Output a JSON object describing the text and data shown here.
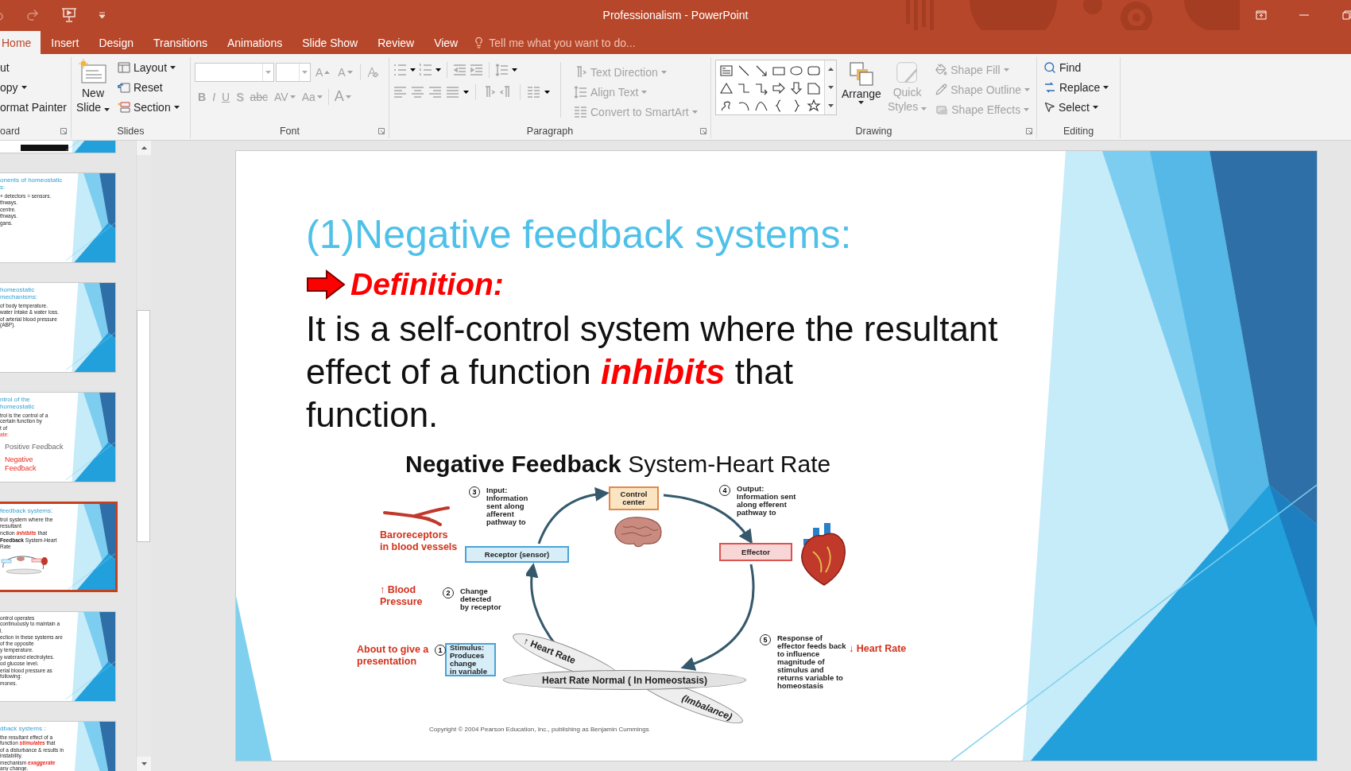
{
  "window": {
    "title": "Professionalism - PowerPoint"
  },
  "tabs": [
    {
      "label": "Home",
      "selected": true
    },
    {
      "label": "Insert",
      "selected": false
    },
    {
      "label": "Design",
      "selected": false
    },
    {
      "label": "Transitions",
      "selected": false
    },
    {
      "label": "Animations",
      "selected": false
    },
    {
      "label": "Slide Show",
      "selected": false
    },
    {
      "label": "Review",
      "selected": false
    },
    {
      "label": "View",
      "selected": false
    }
  ],
  "tell_me": {
    "placeholder": "Tell me what you want to do..."
  },
  "ribbon": {
    "clipboard": {
      "label": "oard",
      "cut": "ut",
      "copy": "opy",
      "format_painter": "ormat Painter"
    },
    "slides": {
      "label": "Slides",
      "new_slide": "New Slide",
      "layout": "Layout",
      "reset": "Reset",
      "section": "Section"
    },
    "font": {
      "label": "Font",
      "disabled": true,
      "grow": "A",
      "shrink": "A",
      "buttons": [
        {
          "text": "B",
          "kind": "bold"
        },
        {
          "text": "I",
          "kind": "italic"
        },
        {
          "text": "U",
          "kind": "underline"
        },
        {
          "text": "S",
          "kind": "shadow"
        },
        {
          "text": "abc",
          "kind": "strike"
        },
        {
          "text": "AV",
          "kind": "spacing"
        },
        {
          "text": "Aa",
          "kind": "case"
        },
        {
          "text": "A",
          "kind": "color"
        }
      ]
    },
    "paragraph": {
      "label": "Paragraph",
      "disabled": true,
      "text_direction": "Text Direction",
      "align_text": "Align Text",
      "convert": "Convert to SmartArt"
    },
    "drawing": {
      "label": "Drawing",
      "arrange": {
        "label": "Arrange",
        "disabled": false
      },
      "quick_styles": {
        "label": "Quick Styles",
        "disabled": true
      },
      "items": [
        {
          "label": "Shape Fill",
          "disabled": true
        },
        {
          "label": "Shape Outline",
          "disabled": true
        },
        {
          "label": "Shape Effects",
          "disabled": true
        }
      ]
    },
    "editing": {
      "label": "Editing",
      "items": [
        {
          "label": "Find"
        },
        {
          "label": "Replace"
        },
        {
          "label": "Select"
        }
      ]
    }
  },
  "thumbnails": [
    {
      "kind": "blank",
      "selected": false
    },
    {
      "kind": "text",
      "selected": false,
      "title": "onents of homeostatic\ns:",
      "lines": [
        {
          "text": "+ detectors = sensors.",
          "kind": "body"
        },
        {
          "text": "thways.",
          "kind": "body"
        },
        {
          "text": "centre.",
          "kind": "body"
        },
        {
          "text": "thways.",
          "kind": "body"
        },
        {
          "text": "gans.",
          "kind": "body"
        }
      ]
    },
    {
      "kind": "text",
      "selected": false,
      "title": "homeostatic mechanisms:",
      "lines": [
        {
          "text": "of body temperature.",
          "kind": "body"
        },
        {
          "text": "water intake & water loss.",
          "kind": "body"
        },
        {
          "text": "of arterial blood pressure (ABP).",
          "kind": "body"
        }
      ]
    },
    {
      "kind": "text",
      "selected": false,
      "title": "ntrol of the homeostatic",
      "lines": [
        {
          "text": "trol is the control of a certain function by",
          "kind": "body"
        },
        {
          "text": "t of",
          "kind": "body"
        },
        {
          "text": "ate:",
          "kind": "accent"
        },
        {
          "text": "Positive Feedback",
          "kind": "large"
        },
        {
          "text": "Negative Feedback",
          "kind": "large-accent"
        }
      ]
    },
    {
      "kind": "diagram",
      "selected": true,
      "title": "feedback systems:",
      "lines": [
        {
          "text": "trol system where the resultant",
          "kind": "medium"
        },
        {
          "text": "nction *inhibits* that",
          "kind": "medium"
        },
        {
          "text": "**Feedback** System-Heart Rate",
          "kind": "tiny"
        }
      ]
    },
    {
      "kind": "text",
      "selected": false,
      "lines": [
        {
          "text": "ontrol operates continuously to maintain a",
          "kind": "body"
        },
        {
          "text": "l.",
          "kind": "body"
        },
        {
          "text": "ection in these systems are of the opposite",
          "kind": "body"
        },
        {
          "text": "y temperature.",
          "kind": "body"
        },
        {
          "text": "y waterand electrolytes.",
          "kind": "body"
        },
        {
          "text": "od glucose level.",
          "kind": "body"
        },
        {
          "text": "erial blood pressure as following:",
          "kind": "body"
        },
        {
          "text": "mones.",
          "kind": "body"
        }
      ]
    },
    {
      "kind": "text",
      "selected": false,
      "title": "dback systems :",
      "lines": [
        {
          "text": "the resultant effect of a function *stimulates* that",
          "kind": "body"
        },
        {
          "text": "of a disturbance & results in instability.",
          "kind": "body"
        },
        {
          "text": "mechanism *exaggerate* any change.",
          "kind": "body"
        }
      ]
    }
  ],
  "slide": {
    "title": "(1)Negative feedback systems:",
    "definition": "Definition:",
    "body": "It is a self-control system where the resultant\neffect of a function *inhibits* that\nfunction.",
    "diagram": {
      "title": "**Negative Feedback** System-Heart Rate",
      "boxes": [
        {
          "kind": "control",
          "text": "Control\ncenter"
        },
        {
          "kind": "receptor",
          "text": "Receptor (sensor)"
        },
        {
          "kind": "effector",
          "text": "Effector"
        },
        {
          "kind": "stimulus",
          "text": "Stimulus:\nProduces\nchange\nin variable"
        }
      ],
      "steps": [
        {
          "number": "3",
          "text": "Input:\nInformation\nsent along\nafferent\npathway to"
        },
        {
          "number": "4",
          "text": "Output:\nInformation sent\nalong efferent\npathway to"
        },
        {
          "number": "2",
          "text": "Change\ndetected\nby receptor"
        },
        {
          "number": "5",
          "text": "Response of\neffector feeds back\nto influence\nmagnitude of\nstimulus and\nreturns variable to\nhomeostasis"
        },
        {
          "number": "1"
        }
      ],
      "labels": [
        "Baroreceptors\nin blood vessels",
        "↑ Blood\nPressure",
        "About to give a\npresentation",
        "↓ Heart Rate"
      ],
      "ellipses": [
        {
          "kind": "rise",
          "text": "↑ Heart Rate"
        },
        {
          "kind": "imbalance",
          "text": "(Imbalance)"
        },
        {
          "kind": "normal",
          "text": "Heart Rate Normal ( In Homeostasis)"
        }
      ],
      "copyright": "Copyright © 2004 Pearson Education, Inc., publishing as Benjamin Cummings"
    }
  }
}
